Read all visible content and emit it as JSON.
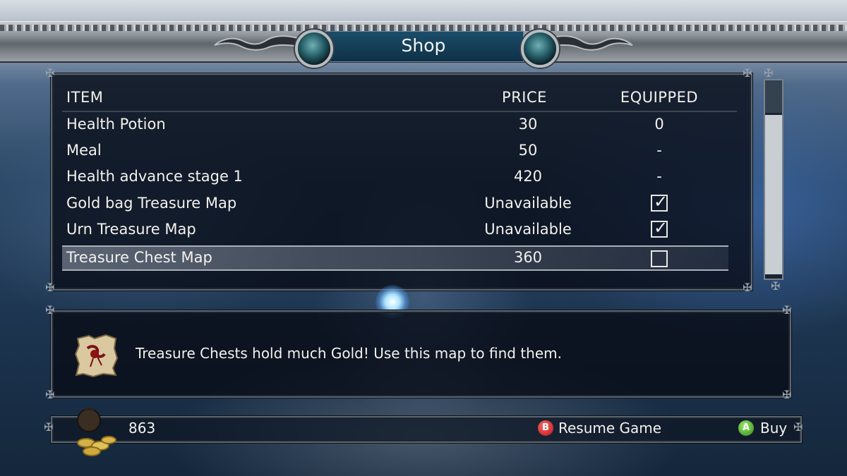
{
  "header": {
    "title": "Shop"
  },
  "table": {
    "columns": [
      "ITEM",
      "PRICE",
      "EQUIPPED"
    ],
    "rows": [
      {
        "name": "Health Potion",
        "price": "30",
        "equipped": "0",
        "type": "text"
      },
      {
        "name": "Meal",
        "price": "50",
        "equipped": "-",
        "type": "text"
      },
      {
        "name": "Health advance stage 1",
        "price": "420",
        "equipped": "-",
        "type": "text"
      },
      {
        "name": "Gold bag Treasure Map",
        "price": "Unavailable",
        "equipped": true,
        "type": "checkbox"
      },
      {
        "name": "Urn Treasure Map",
        "price": "Unavailable",
        "equipped": true,
        "type": "checkbox"
      },
      {
        "name": "Treasure Chest Map",
        "price": "360",
        "equipped": false,
        "type": "checkbox",
        "selected": true
      }
    ]
  },
  "description": {
    "icon": "treasure-map-icon",
    "text": "Treasure Chests hold much Gold! Use this map to find them."
  },
  "footer": {
    "gold_icon": "gold-pouch-icon",
    "gold": "863",
    "resume": {
      "button": "B",
      "label": "Resume Game",
      "color": "#c81a22"
    },
    "buy": {
      "button": "A",
      "label": "Buy",
      "color": "#3f9e1e"
    }
  }
}
